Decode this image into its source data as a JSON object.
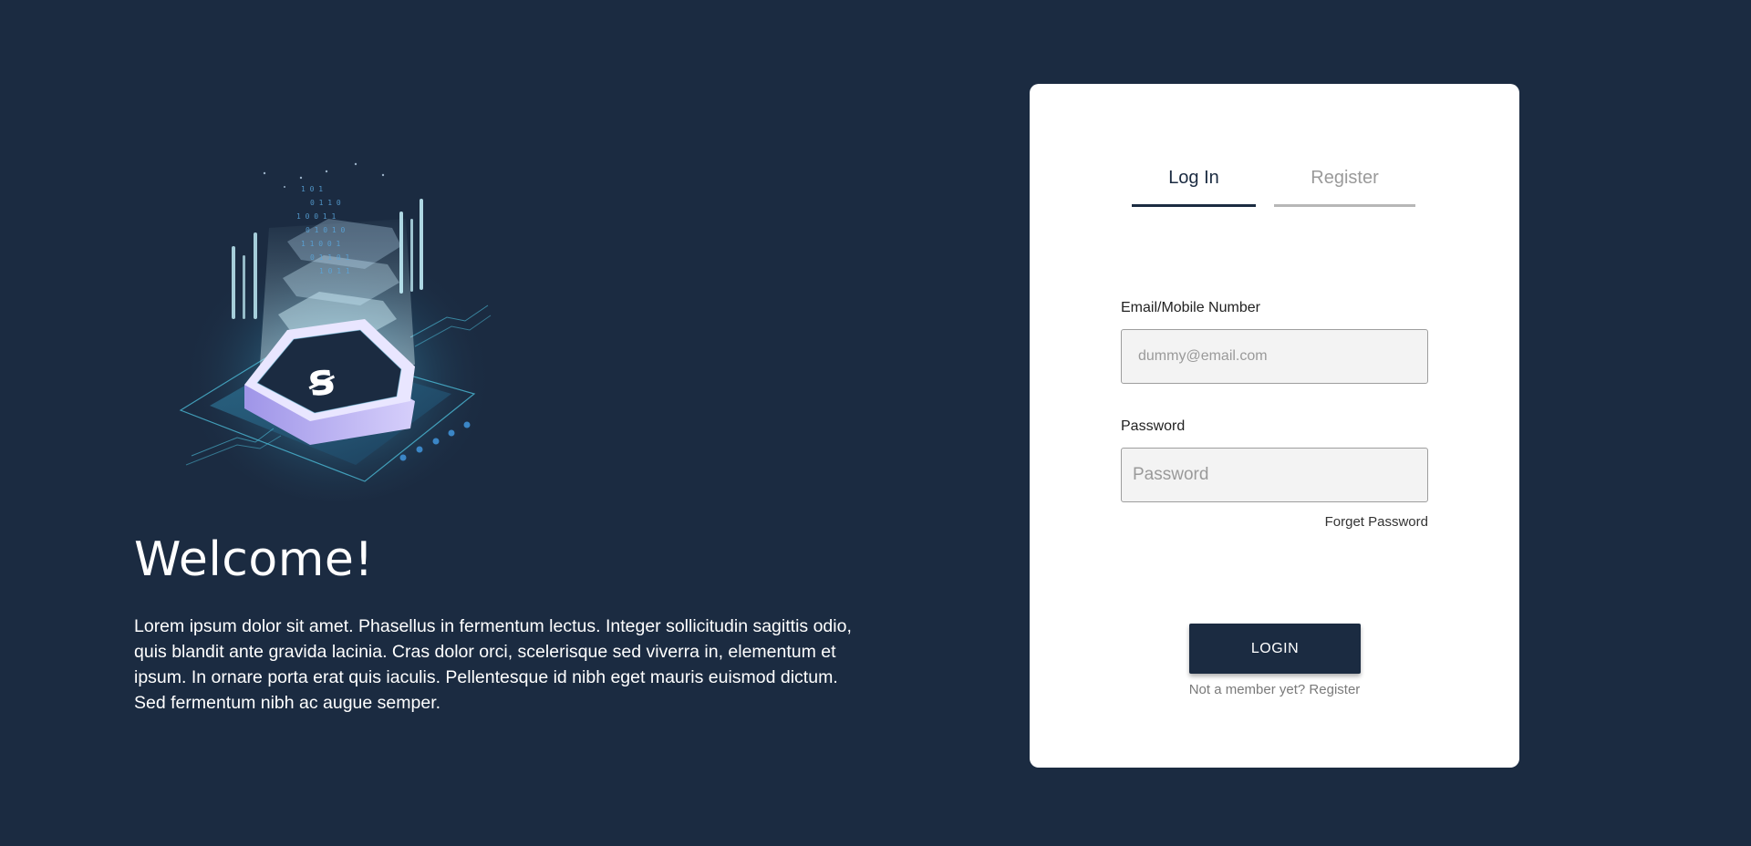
{
  "hero": {
    "illustration_icon": "crypto-chip-illustration",
    "coin_symbol": "ꞩ",
    "title": "Welcome!",
    "description": "Lorem ipsum dolor sit amet. Phasellus in fermentum lectus. Integer sollicitudin sagittis odio, quis blandit ante gravida lacinia. Cras dolor orci, scelerisque sed viverra in, elementum et ipsum. In ornare porta erat quis iaculis. Pellentesque id nibh eget mauris euismod dictum. Sed fermentum nibh ac augue semper."
  },
  "auth": {
    "tabs": [
      {
        "label": "Log In",
        "active": true
      },
      {
        "label": "Register",
        "active": false
      }
    ],
    "email": {
      "label": "Email/Mobile Number",
      "placeholder": "dummy@email.com",
      "value": ""
    },
    "password": {
      "label": "Password",
      "placeholder": "Password",
      "value": ""
    },
    "forgot_label": "Forget Password",
    "login_label": "LOGIN",
    "member_text": "Not a member yet? Register"
  },
  "colors": {
    "background": "#1b2b41",
    "card": "#ffffff",
    "accent": "#1b2b41",
    "inactive_tab": "#9a9a9a"
  }
}
